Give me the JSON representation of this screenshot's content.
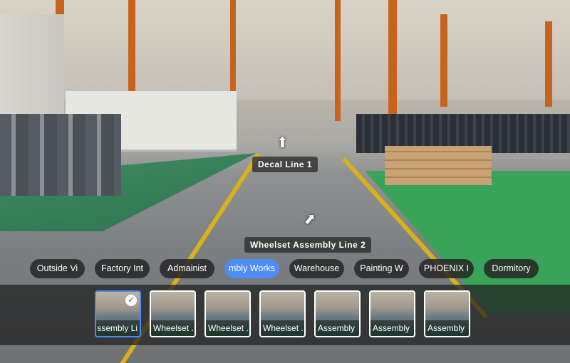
{
  "hotspots": [
    {
      "label": "Decal Line 1"
    },
    {
      "label": "Wheelset Assembly Line 2"
    }
  ],
  "scene_tabs": [
    {
      "label": "Outside Vi",
      "active": false
    },
    {
      "label": "Factory Int",
      "active": false
    },
    {
      "label": "Admainist",
      "active": false
    },
    {
      "label": "mbly Works",
      "active": true
    },
    {
      "label": "Warehouse",
      "active": false
    },
    {
      "label": "Painting W",
      "active": false
    },
    {
      "label": "PHOENIX I",
      "active": false
    },
    {
      "label": "Dormitory",
      "active": false
    }
  ],
  "thumbnails": [
    {
      "label": "ssembly Li",
      "active": true
    },
    {
      "label": "Wheelset .",
      "active": false
    },
    {
      "label": "Wheelset .",
      "active": false
    },
    {
      "label": "Wheelset .",
      "active": false
    },
    {
      "label": "Assembly",
      "active": false
    },
    {
      "label": "Assembly",
      "active": false
    },
    {
      "label": "Assembly",
      "active": false
    }
  ],
  "colors": {
    "accent": "#4d8cf5"
  }
}
